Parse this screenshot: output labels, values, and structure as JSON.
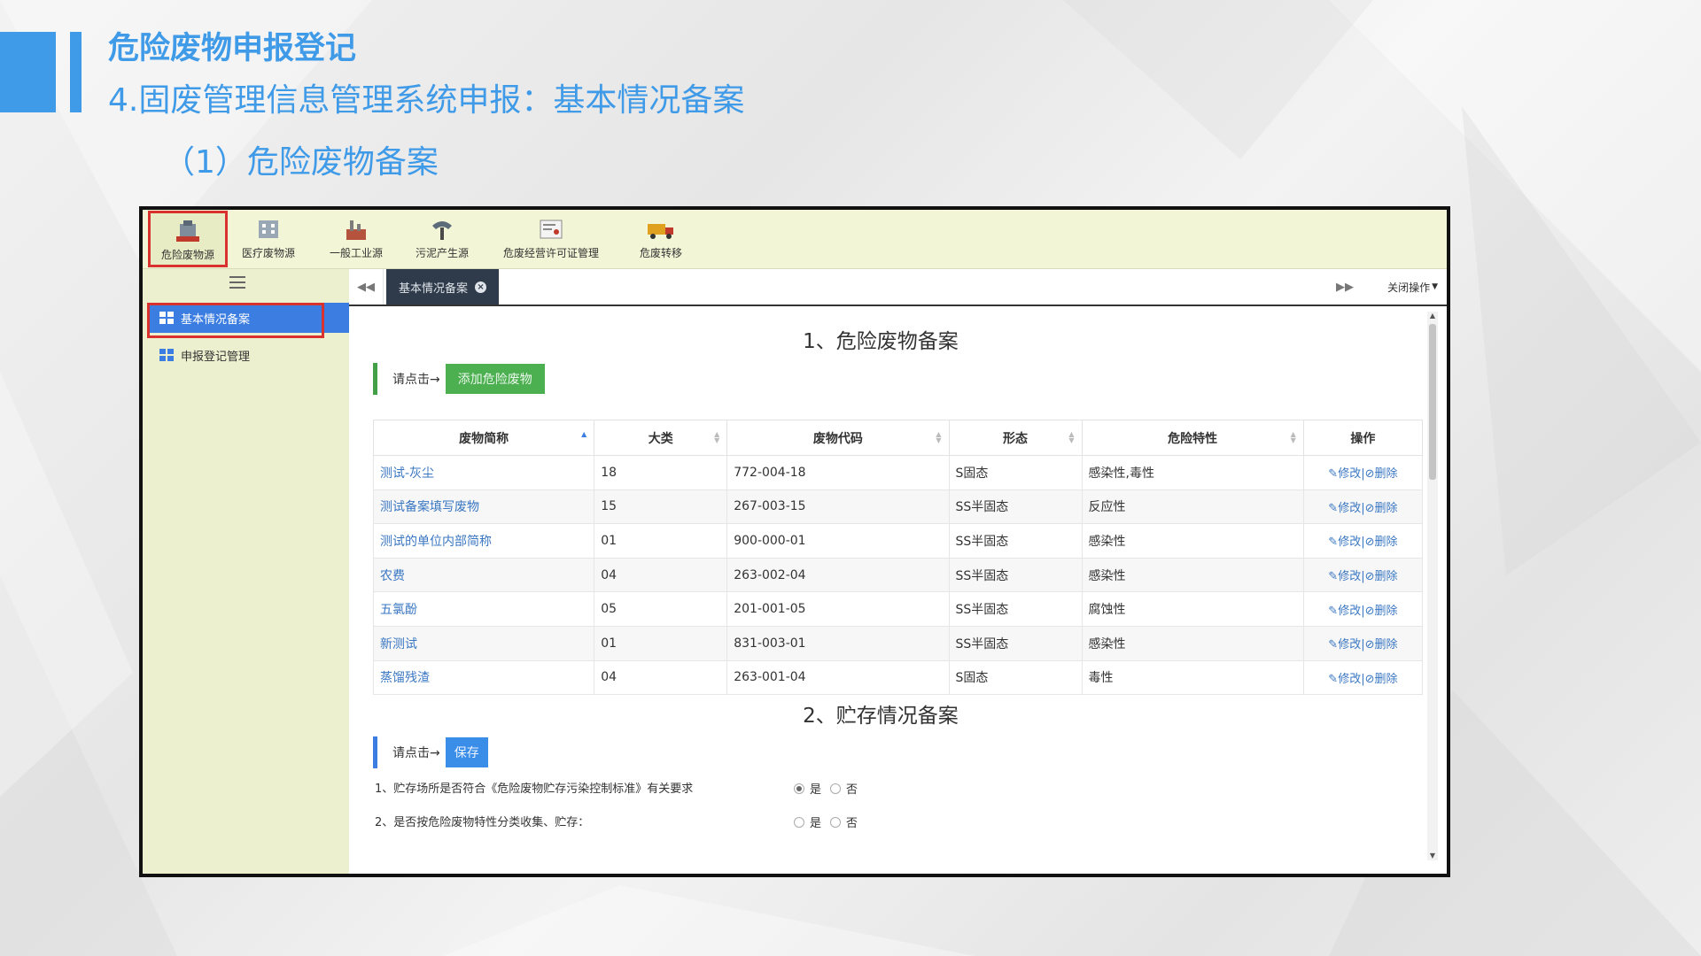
{
  "slide": {
    "title": "危险废物申报登记",
    "subtitle": "4.固废管理信息管理系统申报：基本情况备案",
    "section": "（1）危险废物备案"
  },
  "topnav": {
    "items": [
      {
        "label": "危险废物源",
        "icon": "hazardous-waste-icon",
        "active": true
      },
      {
        "label": "医疗废物源",
        "icon": "medical-waste-icon"
      },
      {
        "label": "一般工业源",
        "icon": "industrial-icon"
      },
      {
        "label": "污泥产生源",
        "icon": "sludge-icon"
      },
      {
        "label": "危废经营许可证管理",
        "icon": "license-icon"
      },
      {
        "label": "危废转移",
        "icon": "transfer-truck-icon"
      }
    ]
  },
  "sidebar": {
    "items": [
      {
        "label": "基本情况备案",
        "active": true
      },
      {
        "label": "申报登记管理"
      }
    ]
  },
  "tabs": {
    "active_tab": "基本情况备案",
    "close_ops": "关闭操作"
  },
  "section1": {
    "title": "1、危险废物备案",
    "prompt": "请点击→",
    "add_button": "添加危险废物",
    "columns": [
      "废物简称",
      "大类",
      "废物代码",
      "形态",
      "危险特性",
      "操作"
    ],
    "rows": [
      {
        "name": "测试-灰尘",
        "category": "18",
        "code": "772-004-18",
        "form": "S固态",
        "hazard": "感染性,毒性"
      },
      {
        "name": "测试备案填写废物",
        "category": "15",
        "code": "267-003-15",
        "form": "SS半固态",
        "hazard": "反应性"
      },
      {
        "name": "测试的单位内部简称",
        "category": "01",
        "code": "900-000-01",
        "form": "SS半固态",
        "hazard": "感染性"
      },
      {
        "name": "农费",
        "category": "04",
        "code": "263-002-04",
        "form": "SS半固态",
        "hazard": "感染性"
      },
      {
        "name": "五氯酚",
        "category": "05",
        "code": "201-001-05",
        "form": "SS半固态",
        "hazard": "腐蚀性"
      },
      {
        "name": "新测试",
        "category": "01",
        "code": "831-003-01",
        "form": "SS半固态",
        "hazard": "感染性"
      },
      {
        "name": "蒸馏残渣",
        "category": "04",
        "code": "263-001-04",
        "form": "S固态",
        "hazard": "毒性"
      }
    ],
    "edit_label": "修改",
    "delete_label": "删除"
  },
  "section2": {
    "title": "2、贮存情况备案",
    "prompt": "请点击→",
    "save_button": "保存",
    "questions": [
      {
        "text": "1、贮存场所是否符合《危险废物贮存污染控制标准》有关要求",
        "yes": "是",
        "no": "否",
        "selected": "yes"
      },
      {
        "text": "2、是否按危险废物特性分类收集、贮存：",
        "yes": "是",
        "no": "否",
        "selected": "none"
      }
    ]
  }
}
